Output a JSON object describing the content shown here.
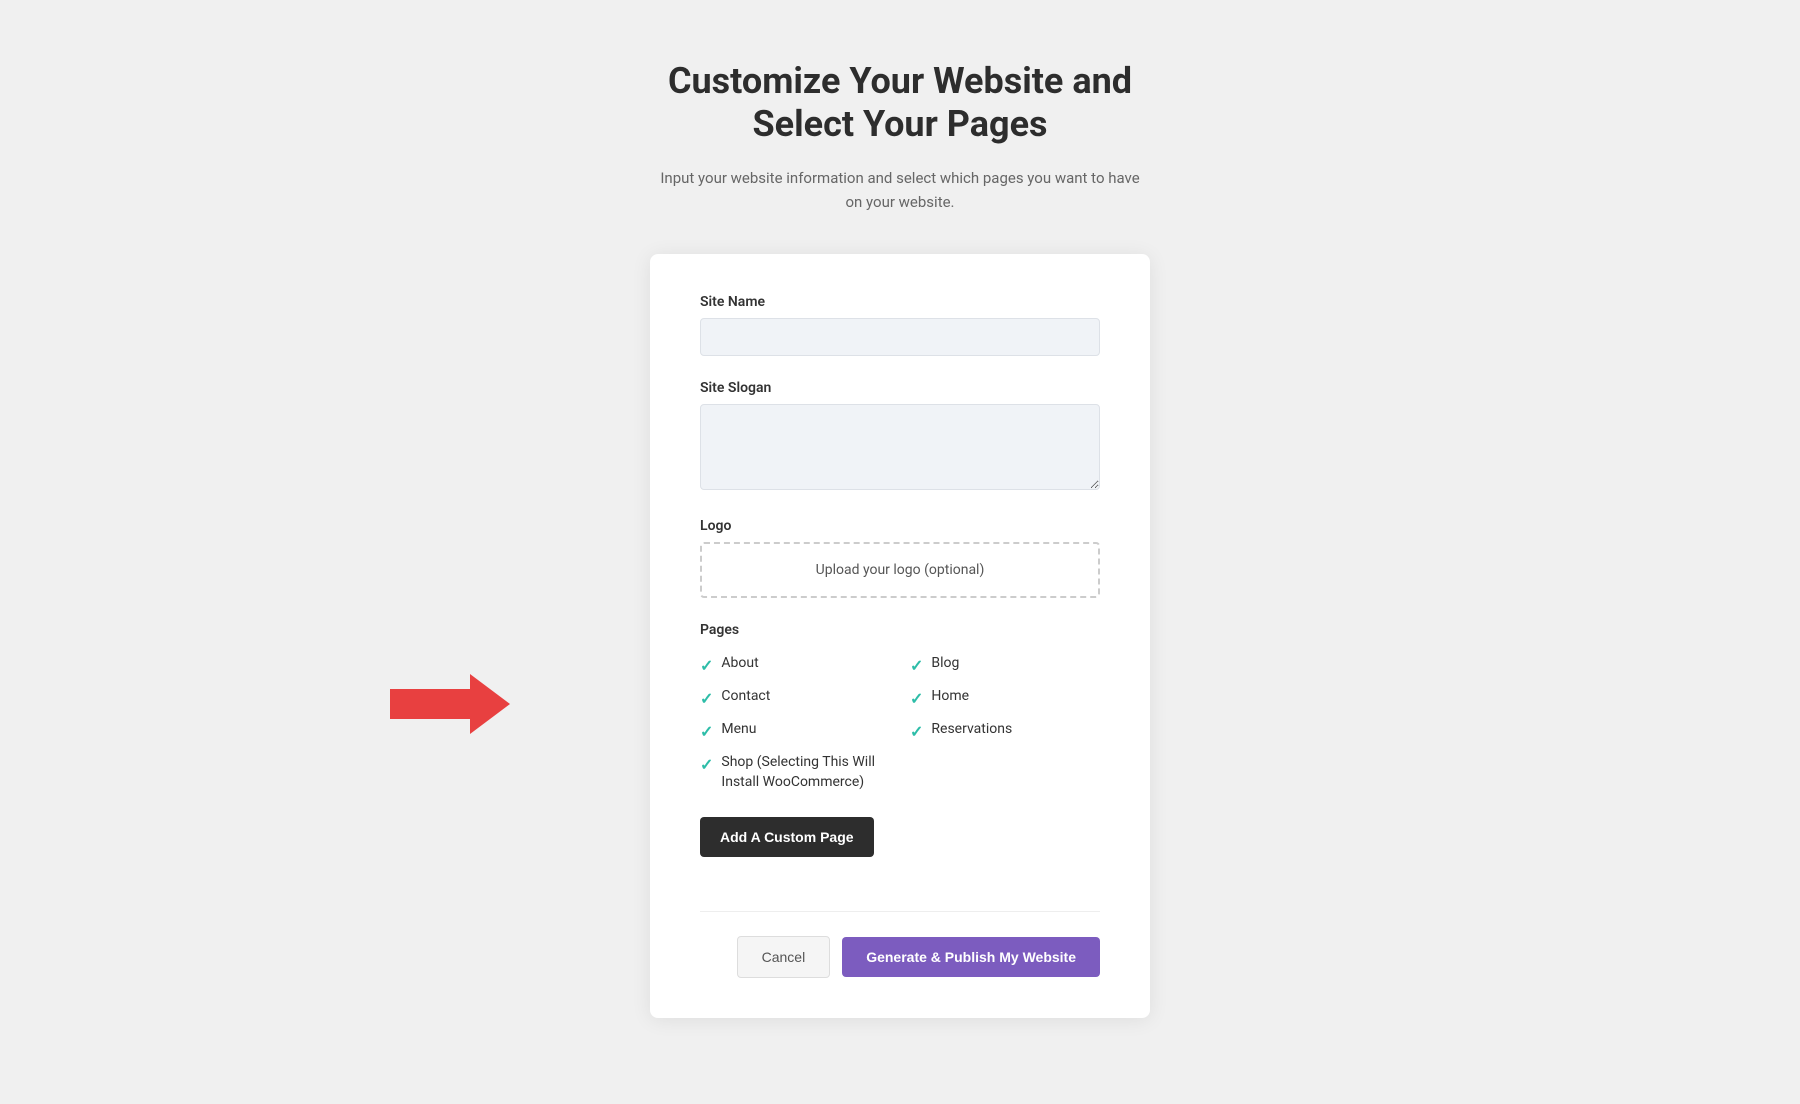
{
  "header": {
    "title_line1": "Customize Your Website and",
    "title_line2": "Select Your Pages",
    "subtitle": "Input your website information and select which pages you want to have on your website."
  },
  "form": {
    "site_name_label": "Site Name",
    "site_name_placeholder": "",
    "site_slogan_label": "Site Slogan",
    "site_slogan_placeholder": "",
    "logo_label": "Logo",
    "logo_upload_text": "Upload your logo (optional)",
    "pages_label": "Pages",
    "pages": [
      {
        "id": "about",
        "label": "About",
        "checked": true,
        "col": 1
      },
      {
        "id": "blog",
        "label": "Blog",
        "checked": true,
        "col": 2
      },
      {
        "id": "contact",
        "label": "Contact",
        "checked": true,
        "col": 1
      },
      {
        "id": "home",
        "label": "Home",
        "checked": true,
        "col": 2
      },
      {
        "id": "menu",
        "label": "Menu",
        "checked": true,
        "col": 1
      },
      {
        "id": "reservations",
        "label": "Reservations",
        "checked": true,
        "col": 2
      },
      {
        "id": "shop",
        "label": "Shop (Selecting This Will Install WooCommerce)",
        "checked": true,
        "col": 1
      }
    ],
    "add_custom_page_label": "Add A Custom Page",
    "cancel_label": "Cancel",
    "generate_label": "Generate & Publish My Website"
  },
  "arrow": {
    "label": "arrow-pointing-right"
  }
}
